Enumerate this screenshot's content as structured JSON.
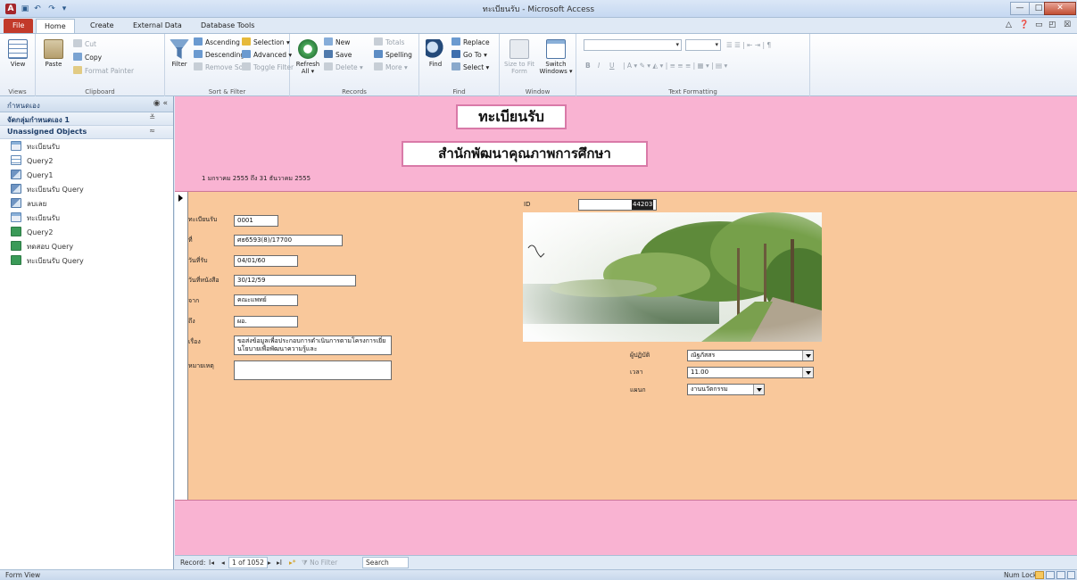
{
  "window": {
    "title": "ทะเบียนรับ - Microsoft Access",
    "app_icon_label": "A",
    "minimize_label": "—",
    "maximize_label": "□",
    "close_label": "✕"
  },
  "ribbon_tabs": [
    "File",
    "Home",
    "Create",
    "External Data",
    "Database Tools"
  ],
  "ribbon": {
    "views": {
      "view_label": "View",
      "group_label": "Views"
    },
    "clipboard": {
      "paste_label": "Paste",
      "cut_label": "Cut",
      "copy_label": "Copy",
      "format_painter_label": "Format Painter",
      "group_label": "Clipboard"
    },
    "sort_filter": {
      "filter_label": "Filter",
      "ascending_label": "Ascending",
      "descending_label": "Descending",
      "remove_sort_label": "Remove Sort",
      "selection_label": "Selection ▾",
      "advanced_label": "Advanced ▾",
      "toggle_filter_label": "Toggle Filter",
      "group_label": "Sort & Filter"
    },
    "records": {
      "refresh_label": "Refresh",
      "refresh_sub": "All ▾",
      "new_label": "New",
      "save_label": "Save",
      "delete_label": "Delete ▾",
      "totals_label": "Totals",
      "spelling_label": "Spelling",
      "more_label": "More ▾",
      "group_label": "Records"
    },
    "find": {
      "find_label": "Find",
      "replace_label": "Replace",
      "goto_label": "Go To ▾",
      "select_label": "Select ▾",
      "group_label": "Find"
    },
    "window": {
      "size_to_fit_label": "Size to Fit Form",
      "switch_windows_label": "Switch Windows ▾",
      "group_label": "Window"
    },
    "text_formatting": {
      "group_label": "Text Formatting",
      "bold": "B",
      "italic": "I",
      "underline": "U"
    }
  },
  "nav_pane": {
    "header": "กำหนดเอง",
    "groups": [
      {
        "label": "จัดกลุ่มกำหนดเอง 1",
        "control": "≚"
      },
      {
        "label": "Unassigned Objects",
        "control": "≈"
      }
    ],
    "items": [
      {
        "label": "ทะเบียนรับ",
        "icon": "form-icon"
      },
      {
        "label": "Query2",
        "icon": "table-icon"
      },
      {
        "label": "Query1",
        "icon": "query-icon"
      },
      {
        "label": "ทะเบียนรับ Query",
        "icon": "query-icon"
      },
      {
        "label": "ลบเลย",
        "icon": "query-icon"
      },
      {
        "label": "ทะเบียนรับ",
        "icon": "form-icon"
      },
      {
        "label": "Query2",
        "icon": "report-icon"
      },
      {
        "label": "ทดสอบ Query",
        "icon": "report-icon"
      },
      {
        "label": "ทะเบียนรับ Query",
        "icon": "report-icon"
      }
    ]
  },
  "form": {
    "title": "ทะเบียนรับ",
    "subtitle": "สำนักพัฒนาคุณภาพการศึกษา",
    "date_range": "1 มกราคม 2555 ถึง 31 ธันวาคม 2555",
    "fields": {
      "reg_no": {
        "label": "ทะเบียนรับ",
        "value": "0001"
      },
      "doc_no": {
        "label": "ที่",
        "value": "ศธ6593(8)/17700"
      },
      "received_date": {
        "label": "วันที่รับ",
        "value": "04/01/60"
      },
      "doc_date": {
        "label": "วันที่หนังสือ",
        "value": "30/12/59"
      },
      "from": {
        "label": "จาก",
        "value": "คณะแพทย์"
      },
      "to": {
        "label": "ถึง",
        "value": "ผอ."
      },
      "subject": {
        "label": "เรื่อง",
        "value": "ขอส่งข้อมูลเพื่อประกอบการดำเนินการตามโครงการเยี่ยนโยบายเพื่อพัฒนาความรู้และ"
      },
      "remark": {
        "label": "หมายเหตุ",
        "value": ""
      },
      "id": {
        "label": "ID",
        "value": "44203"
      },
      "operator": {
        "label": "ผู้ปฏิบัติ",
        "value": "ณัฐภัสสร"
      },
      "time": {
        "label": "เวลา",
        "value": "11.00"
      },
      "department": {
        "label": "แผนก",
        "value": "งานนวัตกรรม"
      }
    }
  },
  "record_nav": {
    "record_label": "Record:",
    "first": "I◂",
    "prev": "◂",
    "counter": "1 of 1052",
    "next": "▸",
    "last": "▸I",
    "new": "▸*",
    "no_filter": "No Filter",
    "search_label": "Search"
  },
  "status": {
    "left": "Form View",
    "right": "Num Lock"
  },
  "colors": {
    "header_pink": "#f9b3d2",
    "detail_peach": "#f9c89b",
    "file_tab": "#c23a2a"
  }
}
